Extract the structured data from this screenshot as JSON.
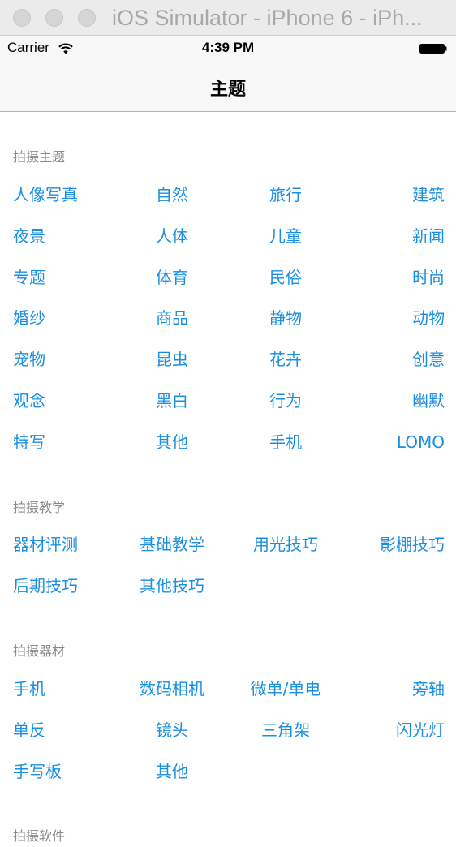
{
  "window": {
    "title": "iOS Simulator - iPhone 6 - iPh..."
  },
  "status_bar": {
    "carrier": "Carrier",
    "time": "4:39 PM"
  },
  "nav": {
    "title": "主题"
  },
  "sections": [
    {
      "header": "拍摄主题",
      "rows": [
        [
          "人像写真",
          "自然",
          "旅行",
          "建筑"
        ],
        [
          "夜景",
          "人体",
          "儿童",
          "新闻"
        ],
        [
          "专题",
          "体育",
          "民俗",
          "时尚"
        ],
        [
          "婚纱",
          "商品",
          "静物",
          "动物"
        ],
        [
          "宠物",
          "昆虫",
          "花卉",
          "创意"
        ],
        [
          "观念",
          "黑白",
          "行为",
          "幽默"
        ],
        [
          "特写",
          "其他",
          "手机",
          "LOMO"
        ]
      ]
    },
    {
      "header": "拍摄教学",
      "rows": [
        [
          "器材评测",
          "基础教学",
          "用光技巧",
          "影棚技巧"
        ],
        [
          "后期技巧",
          "其他技巧"
        ]
      ]
    },
    {
      "header": "拍摄器材",
      "rows": [
        [
          "手机",
          "数码相机",
          "微单/单电",
          "旁轴"
        ],
        [
          "单反",
          "镜头",
          "三角架",
          "闪光灯"
        ],
        [
          "手写板",
          "其他"
        ]
      ]
    },
    {
      "header": "拍摄软件",
      "rows": []
    }
  ]
}
